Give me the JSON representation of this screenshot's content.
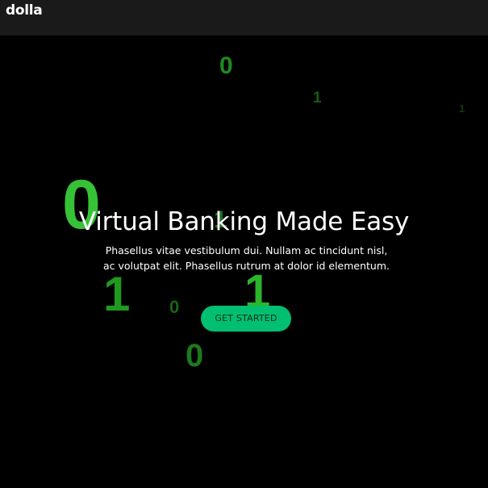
{
  "navbar": {
    "logo": "dolla"
  },
  "hero": {
    "background_digits": [
      "0",
      "1",
      "1",
      "0",
      "1",
      "1",
      "1",
      "0",
      "0"
    ],
    "title": "Virtual Banking Made Easy",
    "description": "Phasellus vitae vestibulum dui. Nullam ac tincidunt nisl, ac volutpat elit. Phasellus rutrum at dolor id elementum.",
    "cta_label": "GET STARTED"
  },
  "colors": {
    "page_background": "#000000",
    "navbar_background": "#1a1a1a",
    "accent_button": "#01bf71",
    "digit_green": "#36c236",
    "text": "#ffffff"
  }
}
